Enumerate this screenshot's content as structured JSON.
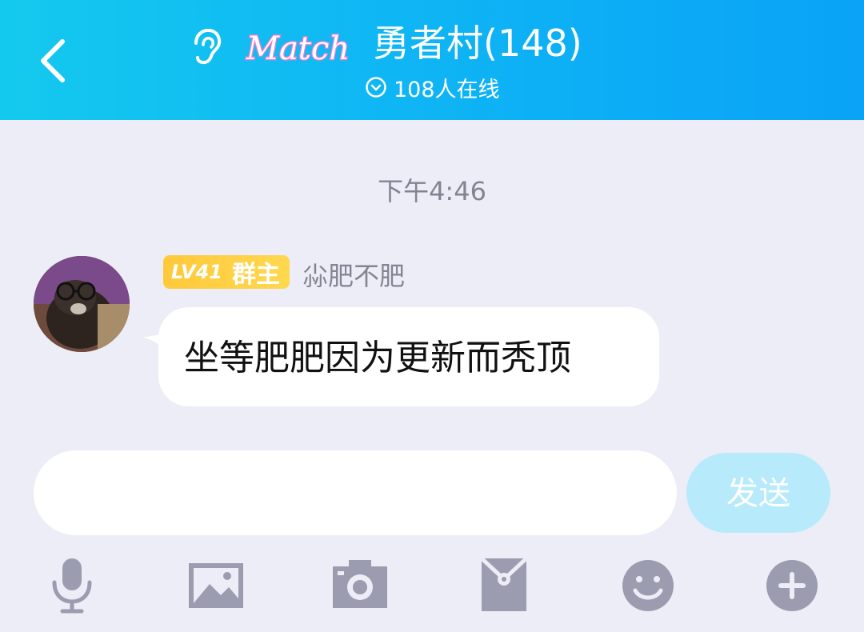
{
  "header": {
    "back_icon": "chevron-left-icon",
    "ear_icon": "ear-icon",
    "logo_text": "Match",
    "group_title": "勇者村(148)",
    "online_icon": "check-circle-icon",
    "online_text": "108人在线"
  },
  "chat": {
    "timestamp": "下午4:46",
    "messages": [
      {
        "level_badge": "LV41",
        "role_badge": "群主",
        "sender": "尛肥不肥",
        "text": "坐等肥肥因为更新而秃顶"
      }
    ]
  },
  "composer": {
    "input_value": "",
    "input_placeholder": "",
    "send_label": "发送"
  },
  "toolbar": {
    "icons": [
      "microphone-icon",
      "image-icon",
      "camera-icon",
      "red-packet-icon",
      "emoji-icon",
      "plus-icon"
    ]
  },
  "colors": {
    "header_start": "#14c9ee",
    "header_end": "#0aa3f7",
    "background": "#ecedf6",
    "send_button": "#b7ebfc",
    "badge": "#ffc93b",
    "toolbar_icon": "#9c9cb0",
    "logo_pink": "#ff79c8"
  }
}
